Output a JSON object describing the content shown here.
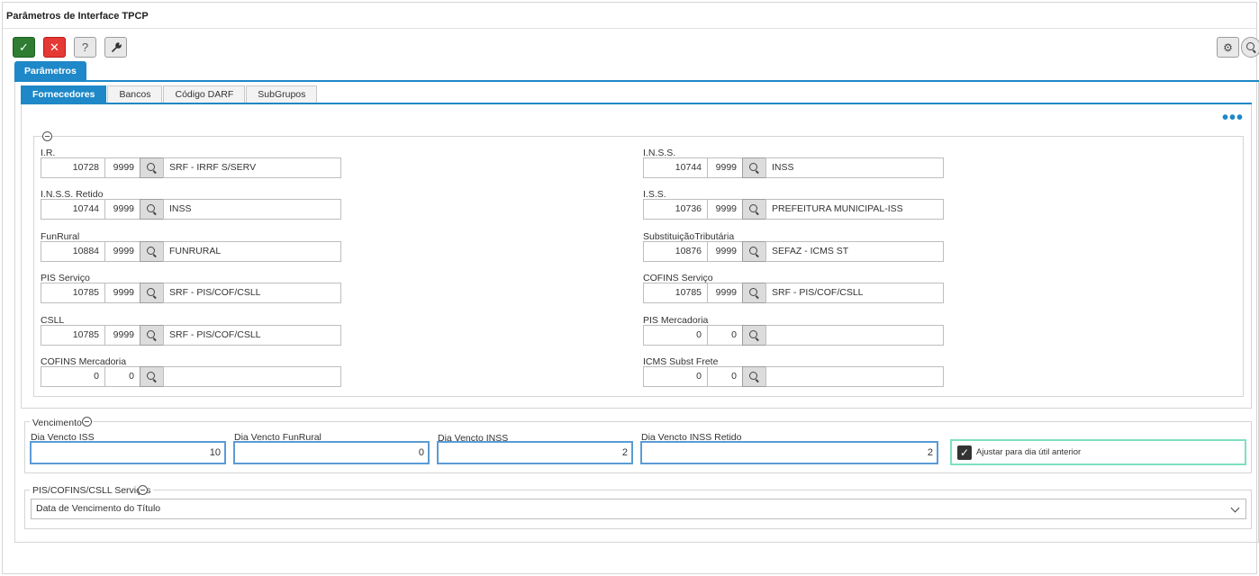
{
  "window": {
    "title": "Parâmetros de Interface TPCP"
  },
  "toolbar": {
    "confirm_icon": "check-icon",
    "cancel_icon": "close-icon",
    "help_label": "?",
    "tools_icon": "wrench-icon",
    "settings_icon": "gear-icon",
    "search_icon": "search-icon"
  },
  "main_tab": {
    "label": "Parâmetros"
  },
  "subtabs": [
    {
      "label": "Fornecedores",
      "active": true
    },
    {
      "label": "Bancos",
      "active": false
    },
    {
      "label": "Código DARF",
      "active": false
    },
    {
      "label": "SubGrupos",
      "active": false
    }
  ],
  "more_menu": "•••",
  "fornecedores": {
    "left": [
      {
        "label": "I.R.",
        "code": "10728",
        "sub": "9999",
        "desc": "SRF - IRRF S/SERV"
      },
      {
        "label": "I.N.S.S. Retido",
        "code": "10744",
        "sub": "9999",
        "desc": "INSS"
      },
      {
        "label": "FunRural",
        "code": "10884",
        "sub": "9999",
        "desc": "FUNRURAL"
      },
      {
        "label": "PIS Serviço",
        "code": "10785",
        "sub": "9999",
        "desc": "SRF - PIS/COF/CSLL"
      },
      {
        "label": "CSLL",
        "code": "10785",
        "sub": "9999",
        "desc": "SRF - PIS/COF/CSLL"
      },
      {
        "label": "COFINS Mercadoria",
        "code": "0",
        "sub": "0",
        "desc": ""
      }
    ],
    "right": [
      {
        "label": "I.N.S.S.",
        "code": "10744",
        "sub": "9999",
        "desc": "INSS"
      },
      {
        "label": "I.S.S.",
        "code": "10736",
        "sub": "9999",
        "desc": "PREFEITURA MUNICIPAL-ISS"
      },
      {
        "label": "SubstituiçãoTributária",
        "code": "10876",
        "sub": "9999",
        "desc": "SEFAZ - ICMS ST"
      },
      {
        "label": "COFINS Serviço",
        "code": "10785",
        "sub": "9999",
        "desc": "SRF - PIS/COF/CSLL"
      },
      {
        "label": "PIS Mercadoria",
        "code": "0",
        "sub": "0",
        "desc": ""
      },
      {
        "label": "ICMS Subst Frete",
        "code": "0",
        "sub": "0",
        "desc": ""
      }
    ]
  },
  "vencimento": {
    "legend": "Vencimento",
    "fields": [
      {
        "label": "Dia Vencto ISS",
        "value": "10"
      },
      {
        "label": "Dia Vencto FunRural",
        "value": "0"
      },
      {
        "label": "Dia Vencto INSS",
        "value": "2"
      },
      {
        "label": "Dia Vencto INSS Retido",
        "value": "2"
      }
    ],
    "checkbox": {
      "label": "Ajustar para dia útil anterior",
      "checked": true
    }
  },
  "pis_cofins": {
    "legend": "PIS/COFINS/CSLL Serviços",
    "selected": "Data de Vencimento do Título"
  }
}
